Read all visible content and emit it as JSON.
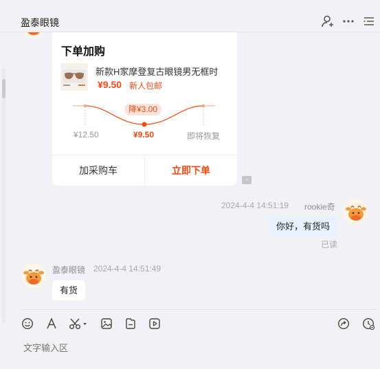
{
  "header": {
    "title": "盈泰眼镜",
    "icons": [
      "add-user-icon",
      "more-icon",
      "menu-icon"
    ]
  },
  "order_card": {
    "title": "下单加购",
    "product_name": "新款H家摩登复古眼镜男无框时",
    "price": "¥9.50",
    "shipping": "新人包邮",
    "price_drop": "降¥3.00",
    "original_price": "¥12.50",
    "current_price": "¥9.50",
    "restore_label": "即将恢复",
    "add_cart_label": "加采购车",
    "buy_now_label": "立即下单",
    "accent_color": "#f04a14"
  },
  "messages": [
    {
      "sender": "rookie奇",
      "time": "2024-4-4 14:51:19",
      "text": "你好，有货吗",
      "status": "已读"
    },
    {
      "sender": "盈泰眼镜",
      "time": "2024-4-4 14:51:49",
      "text": "有货"
    }
  ],
  "toolbar": {
    "icons": [
      "emoji-icon",
      "font-icon",
      "scissors-icon",
      "image-icon",
      "file-icon",
      "video-icon",
      "share-icon",
      "history-icon"
    ]
  },
  "composer": {
    "placeholder": "文字输入区"
  }
}
